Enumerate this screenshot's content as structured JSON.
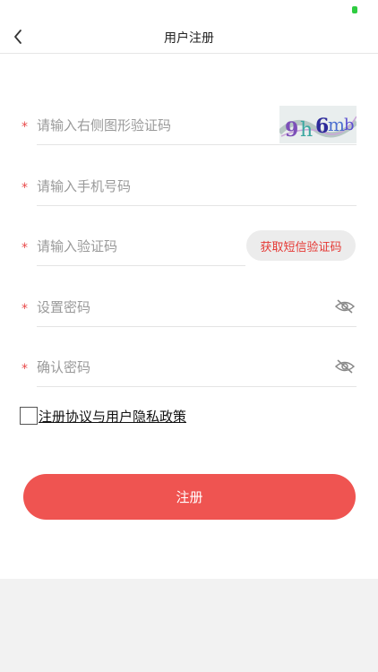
{
  "header": {
    "title": "用户注册"
  },
  "form": {
    "required_mark": "*",
    "captcha_field": {
      "placeholder": "请输入右侧图形验证码",
      "value": ""
    },
    "captcha_image": {
      "text": "9h6mb"
    },
    "phone_field": {
      "placeholder": "请输入手机号码",
      "value": ""
    },
    "sms_code_field": {
      "placeholder": "请输入验证码",
      "value": ""
    },
    "sms_button": {
      "label": "获取短信验证码"
    },
    "password_field": {
      "placeholder": "设置密码",
      "value": ""
    },
    "confirm_password_field": {
      "placeholder": "确认密码",
      "value": ""
    }
  },
  "agreement": {
    "checked": false,
    "label": "注册协议与用户隐私政策"
  },
  "submit": {
    "label": "注册"
  },
  "colors": {
    "accent": "#ef5451",
    "required": "#e94a4a",
    "sms_text": "#e53935",
    "status_dot": "#2ecc40"
  },
  "icons": {
    "back": "chevron-left-icon",
    "eye": "eye-hidden-icon"
  }
}
